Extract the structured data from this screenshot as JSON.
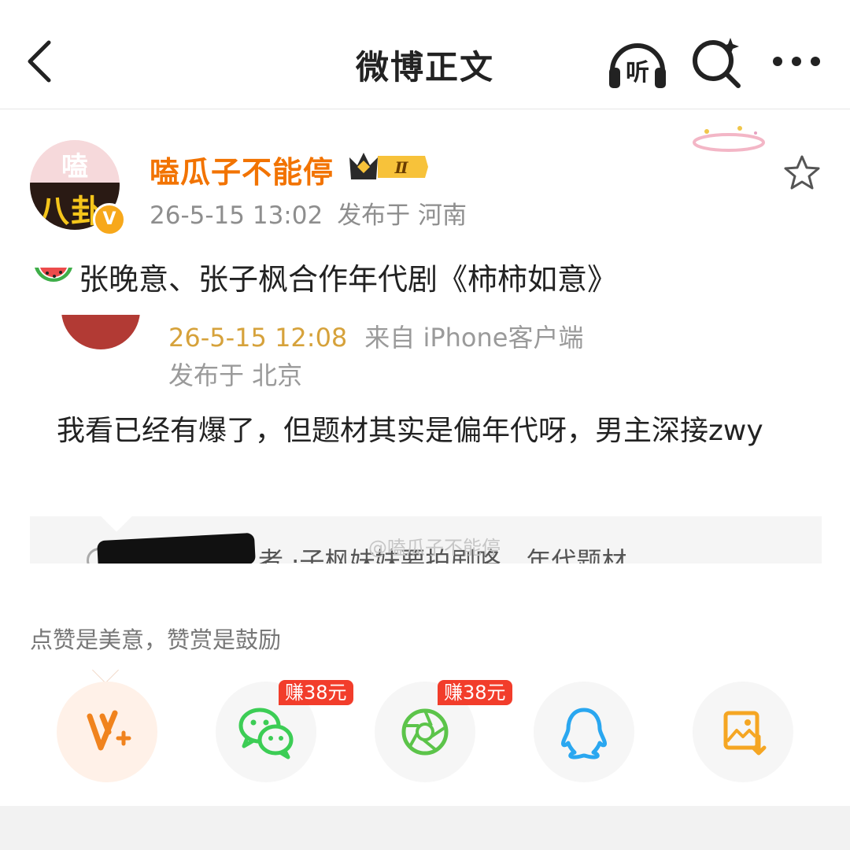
{
  "nav": {
    "title": "微博正文",
    "listen_label": "听"
  },
  "post": {
    "avatar_text_top": "嗑",
    "avatar_text_bottom": "八卦",
    "verified_mark": "V",
    "username": "嗑瓜子不能停",
    "level_badge": "Ⅱ",
    "time": "26-5-15 13:02",
    "location": "发布于 河南",
    "text": "张晚意、张子枫合作年代剧《柿柿如意》"
  },
  "quoted": {
    "time": "26-5-15 12:08",
    "source": "来自 iPhone客户端",
    "location": "发布于 北京",
    "body": "我看已经有爆了，但题材其实是偏年代呀，男主深接zwy",
    "preview_text": "者 ·子枫妹妹要拍剧咯，年代题材",
    "watermark": "@嗑瓜子不能停"
  },
  "reward": {
    "text": "点赞是美意，赞赏是鼓励"
  },
  "share": {
    "items": [
      {
        "name": "vplus",
        "icon": "v-plus-icon",
        "badge": ""
      },
      {
        "name": "wechat",
        "icon": "wechat-icon",
        "badge": "赚38元"
      },
      {
        "name": "moments",
        "icon": "moments-icon",
        "badge": "赚38元"
      },
      {
        "name": "qq",
        "icon": "qq-icon",
        "badge": ""
      },
      {
        "name": "save-image",
        "icon": "save-image-icon",
        "badge": ""
      }
    ]
  },
  "colors": {
    "username": "#f27300",
    "wechat": "#3ccd55",
    "moments": "#5cc44a",
    "qq": "#2aa7f0",
    "save": "#f5a623",
    "earn_badge": "#f23d2b"
  }
}
